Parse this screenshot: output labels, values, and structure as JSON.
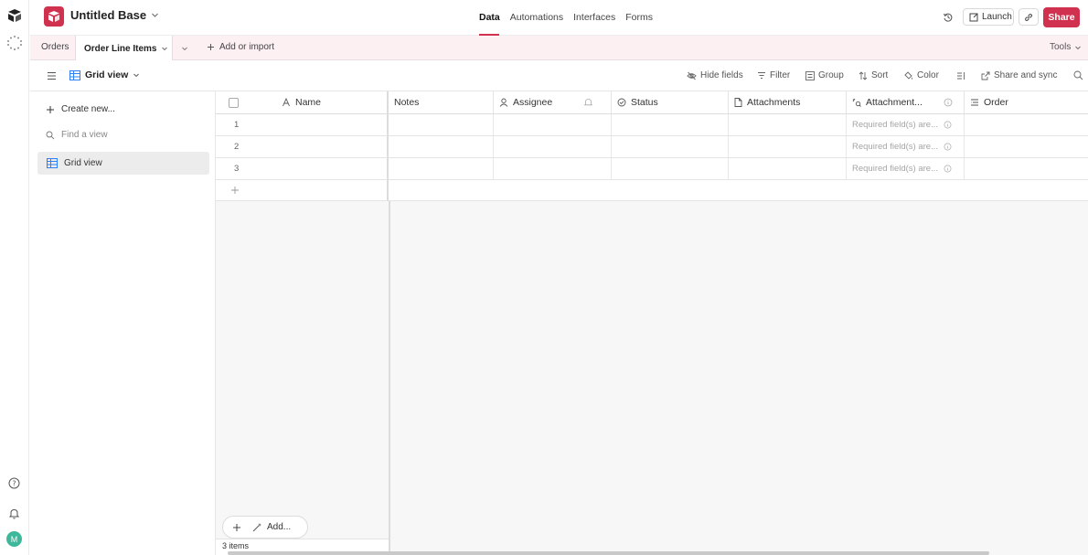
{
  "app": {
    "base_title": "Untitled Base",
    "brand_color": "#d0314e"
  },
  "nav": {
    "tabs": [
      "Data",
      "Automations",
      "Interfaces",
      "Forms"
    ],
    "active_tab": "Data"
  },
  "topbar_right": {
    "launch_label": "Launch",
    "share_label": "Share"
  },
  "tables": {
    "items": [
      "Orders",
      "Order Line Items"
    ],
    "active": "Order Line Items",
    "add_label": "Add or import",
    "tools_label": "Tools"
  },
  "viewbar": {
    "view_name": "Grid view",
    "actions": {
      "hide_fields": "Hide fields",
      "filter": "Filter",
      "group": "Group",
      "sort": "Sort",
      "color": "Color",
      "share_sync": "Share and sync"
    }
  },
  "sidebar": {
    "create_label": "Create new...",
    "find_placeholder": "Find a view",
    "views": [
      "Grid view"
    ]
  },
  "grid": {
    "columns": [
      {
        "name": "Name",
        "icon": "text-field-icon"
      },
      {
        "name": "Notes",
        "icon": ""
      },
      {
        "name": "Assignee",
        "icon": "user-field-icon"
      },
      {
        "name": "Status",
        "icon": "status-field-icon"
      },
      {
        "name": "Attachments",
        "icon": "document-field-icon"
      },
      {
        "name": "Attachment...",
        "icon": "formula-field-icon"
      },
      {
        "name": "Order",
        "icon": "link-field-icon"
      }
    ],
    "rows": [
      {
        "number": "1",
        "required_text": "Required field(s) are..."
      },
      {
        "number": "2",
        "required_text": "Required field(s) are..."
      },
      {
        "number": "3",
        "required_text": "Required field(s) are..."
      }
    ],
    "add_label": "Add...",
    "record_count": "3 items"
  },
  "user": {
    "avatar_initial": "M",
    "avatar_color": "#3eb89a"
  }
}
